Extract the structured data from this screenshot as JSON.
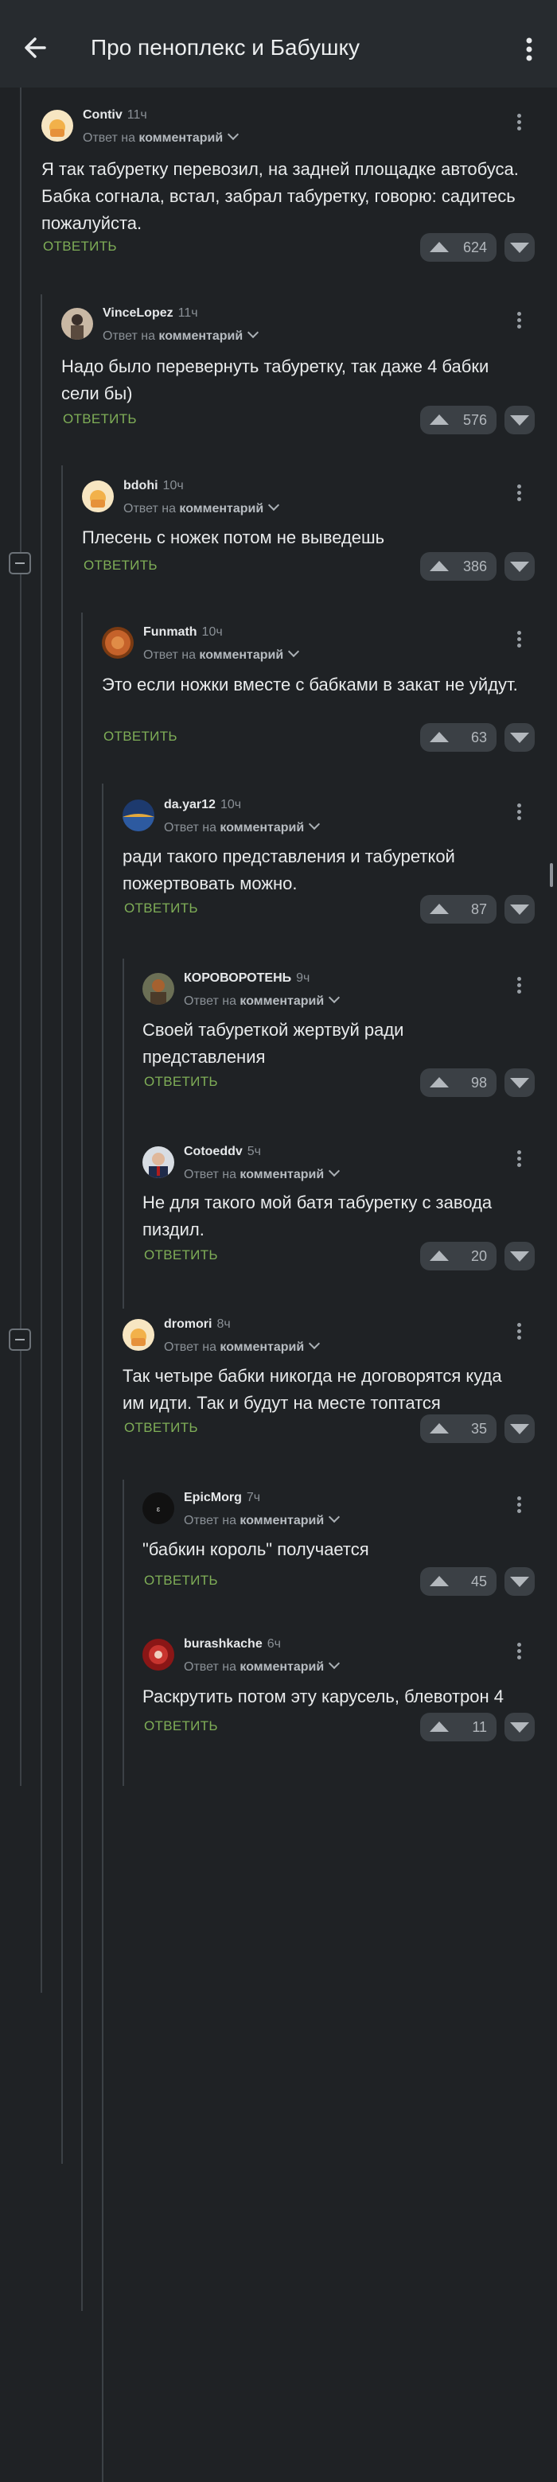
{
  "header": {
    "title": "Про пеноплекс и Бабушку"
  },
  "reply_label": "Ответ на",
  "reply_target": "комментарий",
  "reply_button": "ОТВЕТИТЬ",
  "comments": [
    {
      "author": "Contiv",
      "time": "11ч",
      "text": "Я так табуретку перевозил, на задней площадке автобуса. Бабка согнала, встал, забрал табуретку, говорю: садитесь пожалуйста.",
      "votes": "624"
    },
    {
      "author": "VinceLopez",
      "time": "11ч",
      "text": "Надо было перевернуть табуретку, так даже 4 бабки сели бы)",
      "votes": "576"
    },
    {
      "author": "bdohi",
      "time": "10ч",
      "text": "Плесень с ножек потом не выведешь",
      "votes": "386"
    },
    {
      "author": "Funmath",
      "time": "10ч",
      "text": "Это если ножки вместе с бабками в закат не уйдут.",
      "votes": "63"
    },
    {
      "author": "da.yar12",
      "time": "10ч",
      "text": "ради такого представления и табуреткой пожертвовать можно.",
      "votes": "87"
    },
    {
      "author": "КОРОВОРОТЕНЬ",
      "time": "9ч",
      "text": "Своей табуреткой жертвуй ради представления",
      "votes": "98"
    },
    {
      "author": "Cotoeddv",
      "time": "5ч",
      "text": "Не для такого мой батя табуретку с завода пиздил.",
      "votes": "20"
    },
    {
      "author": "dromori",
      "time": "8ч",
      "text": "Так четыре бабки никогда не договорятся куда им идти. Так и будут на месте топтатся",
      "votes": "35"
    },
    {
      "author": "EpicMorg",
      "time": "7ч",
      "text": "\"бабкин король\" получается",
      "votes": "45"
    },
    {
      "author": "burashkache",
      "time": "6ч",
      "text": "Раскрутить потом эту карусель, блевотрон 4",
      "votes": "11"
    }
  ],
  "icons": {
    "back": "arrow-left-icon",
    "menu": "more-vertical-icon",
    "upvote": "triangle-up-icon",
    "downvote": "triangle-down-icon"
  },
  "colors": {
    "background": "#1f2225",
    "header": "#272b2f",
    "accent": "#7fae57",
    "vote_bg": "#3b4045"
  }
}
